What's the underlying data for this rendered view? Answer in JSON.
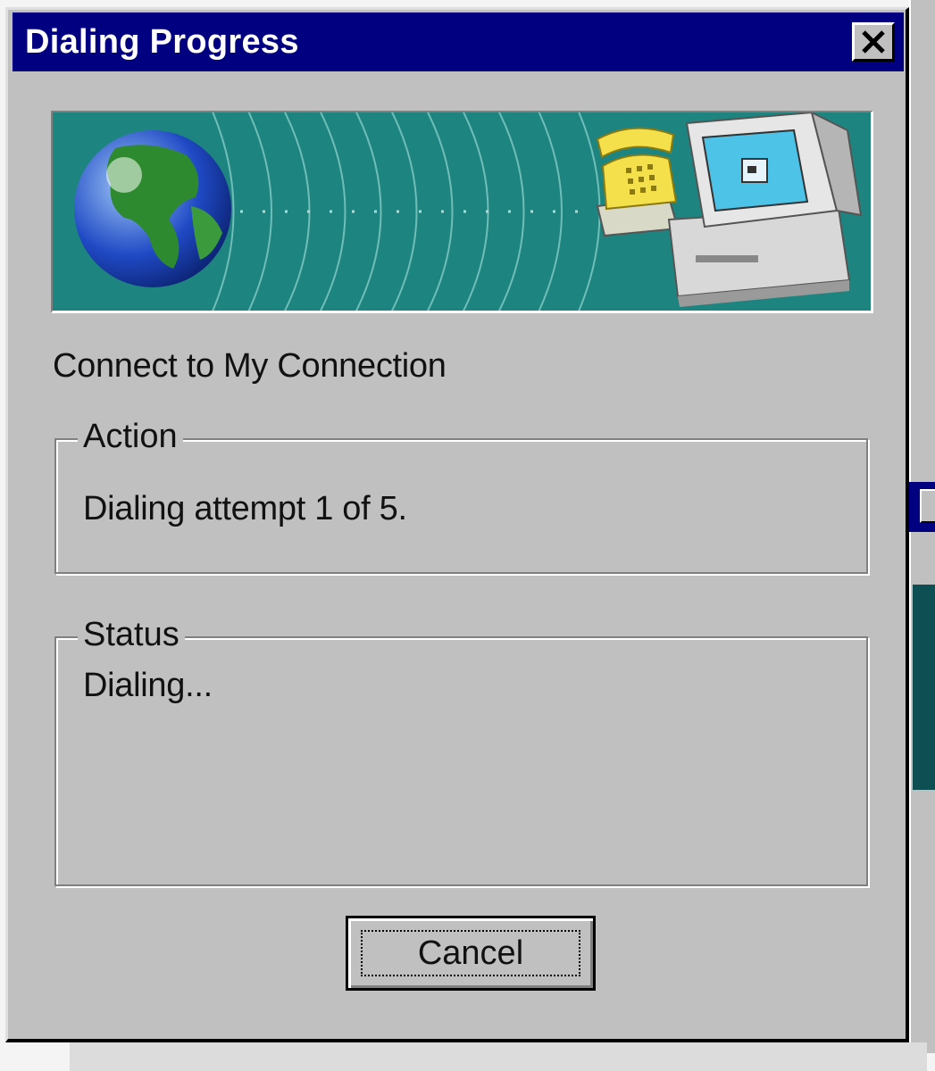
{
  "dialog": {
    "title": "Dialing Progress",
    "close_glyph": "✕",
    "banner_icons": [
      "globe-icon",
      "telephone-icon",
      "computer-icon"
    ],
    "connect_text": "Connect to My Connection",
    "action": {
      "legend": "Action",
      "value": "Dialing attempt 1 of 5."
    },
    "status": {
      "legend": "Status",
      "value": "Dialing..."
    },
    "cancel_label": "Cancel"
  },
  "colors": {
    "titlebar": "#000080",
    "face": "#c0c0c0",
    "banner": "#1d8480"
  }
}
